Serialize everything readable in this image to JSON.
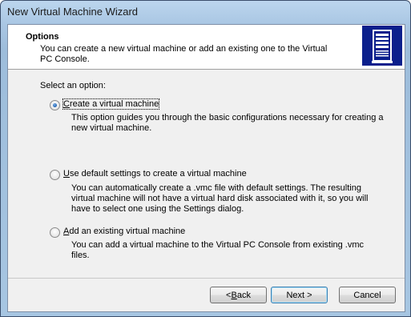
{
  "window": {
    "title": "New Virtual Machine Wizard"
  },
  "header": {
    "title": "Options",
    "description": "You can create a new virtual machine or add an existing one to the Virtual PC Console.",
    "icon": "server-tower-icon"
  },
  "body": {
    "prompt": "Select an option:",
    "options": [
      {
        "label_accel": "C",
        "label_rest": "reate a virtual machine",
        "description": "This option guides you through the basic configurations necessary for creating a new virtual machine.",
        "checked": true
      },
      {
        "label_accel": "U",
        "label_rest": "se default settings to create a virtual machine",
        "description": "You can automatically create a .vmc file with default settings. The resulting virtual machine will not have a virtual hard disk associated with it, so you will have to select one using the Settings dialog.",
        "checked": false
      },
      {
        "label_accel": "A",
        "label_rest": "dd an existing virtual machine",
        "description": "You can add a virtual machine to the Virtual PC Console from existing .vmc files.",
        "checked": false
      }
    ]
  },
  "footer": {
    "back_prefix": "< ",
    "back_accel": "B",
    "back_rest": "ack",
    "next_label": "Next >",
    "cancel_label": "Cancel"
  }
}
